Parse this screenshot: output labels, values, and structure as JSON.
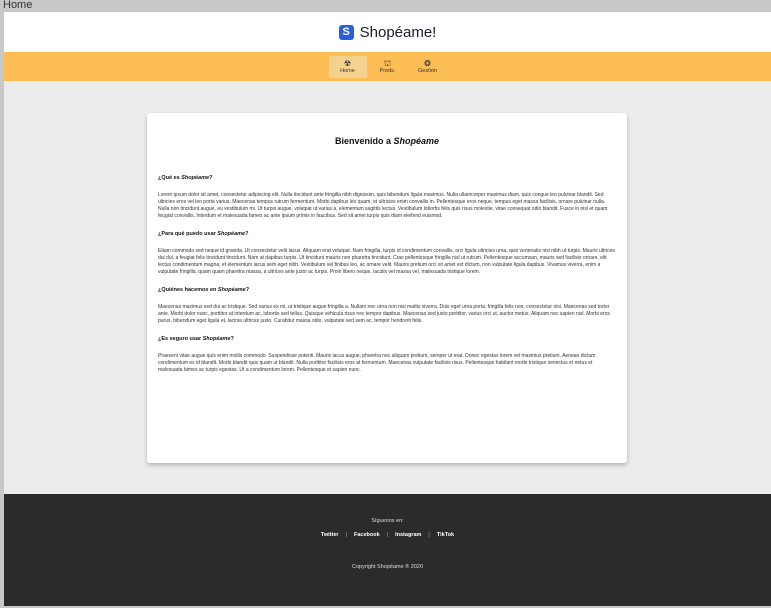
{
  "window": {
    "tab_title": "Home"
  },
  "brand": {
    "logo_letter": "S",
    "name": "Shopéame!"
  },
  "nav": {
    "tabs": [
      {
        "label": "Home",
        "icon": "home-icon",
        "glyph": "☢",
        "active": true
      },
      {
        "label": "Prods.",
        "icon": "binoculars-icon",
        "glyph": "⛫",
        "active": false
      },
      {
        "label": "Gestión",
        "icon": "bug-icon",
        "glyph": "❂",
        "active": false
      }
    ]
  },
  "main": {
    "title_prefix": "Bienvenido a ",
    "title_em": "Shopéame",
    "sections": [
      {
        "heading_prefix": "¿Qué es ",
        "heading_em": "Shopéame",
        "heading_suffix": "?",
        "body": "Lorem ipsum dolor sit amet, consectetur adipiscing elit. Nulla tincidunt ante fringilla nibh dignissim, quis bibendum ligula maximus. Nulla ullamcorper maximus diam, quis congue leo pulvinar blandit. Sed ultricies eros vel leo porta varius. Maecenas tempus rutrum fermentum. Morbi dapibus leo quam, et ultricies enim convallis in. Pellentesque eros neque, tempus eget massa facilisis, ornare pulvinar nulla. Nulla non tincidunt augue, eu vestibulum mi. Ut turpis augue, volutpat ut varius a, elementum sagittis lectus. Vestibulum lobortis felis quis risus molestie, vitae consequat odio blandit. Fusce in nisl et quam feugiat convallis. Interdum et malesuada fames ac ante ipsum primis in faucibus. Sed sit amet turpis quis diam eleifend euismod."
      },
      {
        "heading_prefix": "¿Para qué puedo usar ",
        "heading_em": "Shopéame",
        "heading_suffix": "?",
        "body": "Etiam commodo sed neque id gravida. Ut consectetur velit lacus. Aliquam erat volutpat. Nam fringilla, turpis id condimentum convallis, orci ligula ultricies urna, quis venenatis nisi nibh ut turpis. Mauris ultrices dui dui, a feugiat felis tincidunt tincidunt. Nam at dapibus turpis. Ut tincidunt mauris non pharetra tincidunt. Cras pellentesque fringilla nisl ut rutrum. Pellentesque accumsan, mauris sed facilisis ornare, elit lectus condimentum magna, et elementum lacus sem eget nibh. Vestibulum vel finibus leo, ac ornare velit. Mauris pretium orci sit amet est dictum, non vulputate ligula dapibus. Vivamus viverra, enim a vulputate fringilla, quam quam pharetra massa, a ultrices ante justo ac turpis. Proin libero neque, iaculis vel massa vel, malesuada tristique lorem."
      },
      {
        "heading_prefix": "¿Quiénes hacemos en ",
        "heading_em": "Shopéame",
        "heading_suffix": "?",
        "body": "Maecenas maximus sed dui ac tristique. Sed varius ex mi, ut tristique augue fringilla a. Nullam nec urna non nisi mattis viverra. Duis eget urna porta, fringilla felis non, consectetur nisi. Maecenas sed tortor ante. Morbi dolor nunc, porttitor at interdum ac, lobortis sed tellus. Quisque vehicula risus nec tempor dapibus. Maecenas sed justo porttitor, varius orci ut, auctor metus. Aliquam nec sapien nisl. Morbi eros purus, bibendum eget ligula et, lacinia ultrices justo. Curabitur massa odio, vulputate sed sem ac, tempor hendrerit felis."
      },
      {
        "heading_prefix": "¿Es seguro usar ",
        "heading_em": "Shopéame",
        "heading_suffix": "?",
        "body": "Praesent vitae augue quis enim mollis commodo. Suspendisse potenti. Mauris lacus augue, pharetra nec aliquam pretium, semper ut erat. Donec egestas lorem vel maximus pretium. Aenean dictum condimentum ex id blandit. Morbi blandit quis quam ut blandit. Nulla porttitor facilisis eros at fermentum. Maecenas vulputate facilisis risus. Pellentesque habitant morbi tristique senectus et netus et malesuada fames ac turpis egestas. Ut a condimentum lorem. Pellentesque et sapien nunc."
      }
    ]
  },
  "footer": {
    "follow_label": "Síguenos en:",
    "socials": [
      "Twitter",
      "Facebook",
      "Instagram",
      "TikTok"
    ],
    "copyright": "Copyright Shopéame ® 2020"
  },
  "colors": {
    "nav_bg": "#fdbf55",
    "nav_active": "#f4d18f",
    "logo_bg": "#2b5fd9",
    "footer_bg": "#2b2b2b",
    "page_bg": "#ececec"
  }
}
